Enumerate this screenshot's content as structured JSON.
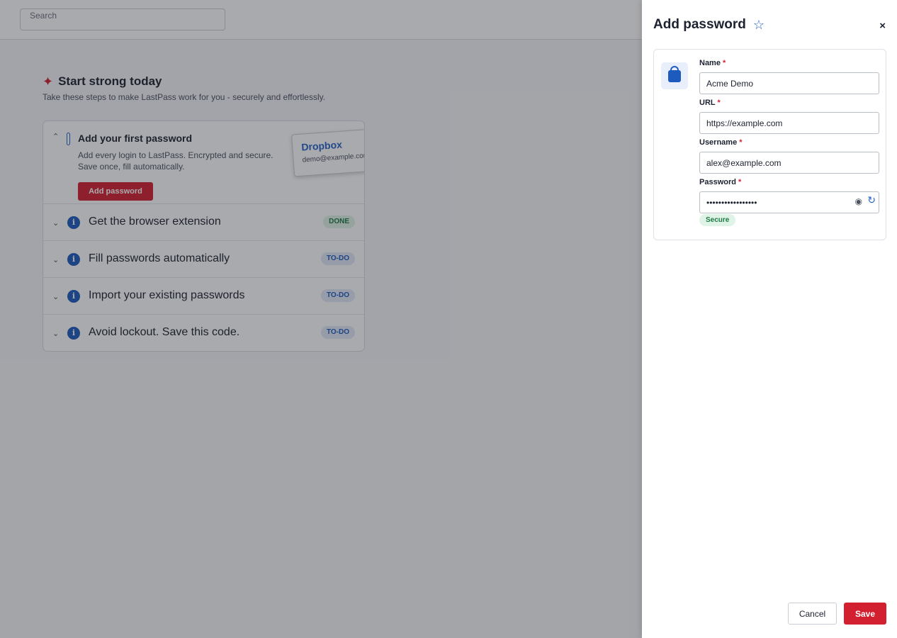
{
  "search": {
    "placeholder": "Search"
  },
  "onboarding": {
    "title": "Start strong today",
    "subtitle": "Take these steps to make LastPass work for you - securely and effortlessly.",
    "expanded_step": {
      "title": "Add your first password",
      "description": "Add every login to LastPass. Encrypted and secure. Save once, fill automatically.",
      "button_label": "Add password",
      "preview_card": {
        "name": "Dropbox",
        "email": "demo@example.com"
      }
    },
    "steps": [
      {
        "label": "Get the browser extension",
        "status": "DONE"
      },
      {
        "label": "Fill passwords automatically",
        "status": "TO-DO"
      },
      {
        "label": "Import your existing passwords",
        "status": "TO-DO"
      },
      {
        "label": "Avoid lockout. Save this code.",
        "status": "TO-DO"
      }
    ]
  },
  "drawer": {
    "title": "Add password",
    "close_label": "×",
    "fields": {
      "name": {
        "label": "Name",
        "value": "Acme Demo"
      },
      "url": {
        "label": "URL",
        "value": "https://example.com"
      },
      "username": {
        "label": "Username",
        "value": "alex@example.com"
      },
      "password": {
        "label": "Password",
        "value": "•••••••••••••••••"
      }
    },
    "strength_badge": "Secure",
    "cancel_label": "Cancel",
    "save_label": "Save"
  },
  "colors": {
    "accent_red": "#d32030",
    "accent_blue": "#2563c9",
    "success_green": "#1c7a45"
  },
  "icons": [
    "sparkle-icon",
    "pen-icon",
    "info-icon",
    "chevron-up-icon",
    "chevron-down-icon",
    "star-icon",
    "close-icon",
    "shopping-bag-icon",
    "eye-icon",
    "refresh-icon"
  ]
}
